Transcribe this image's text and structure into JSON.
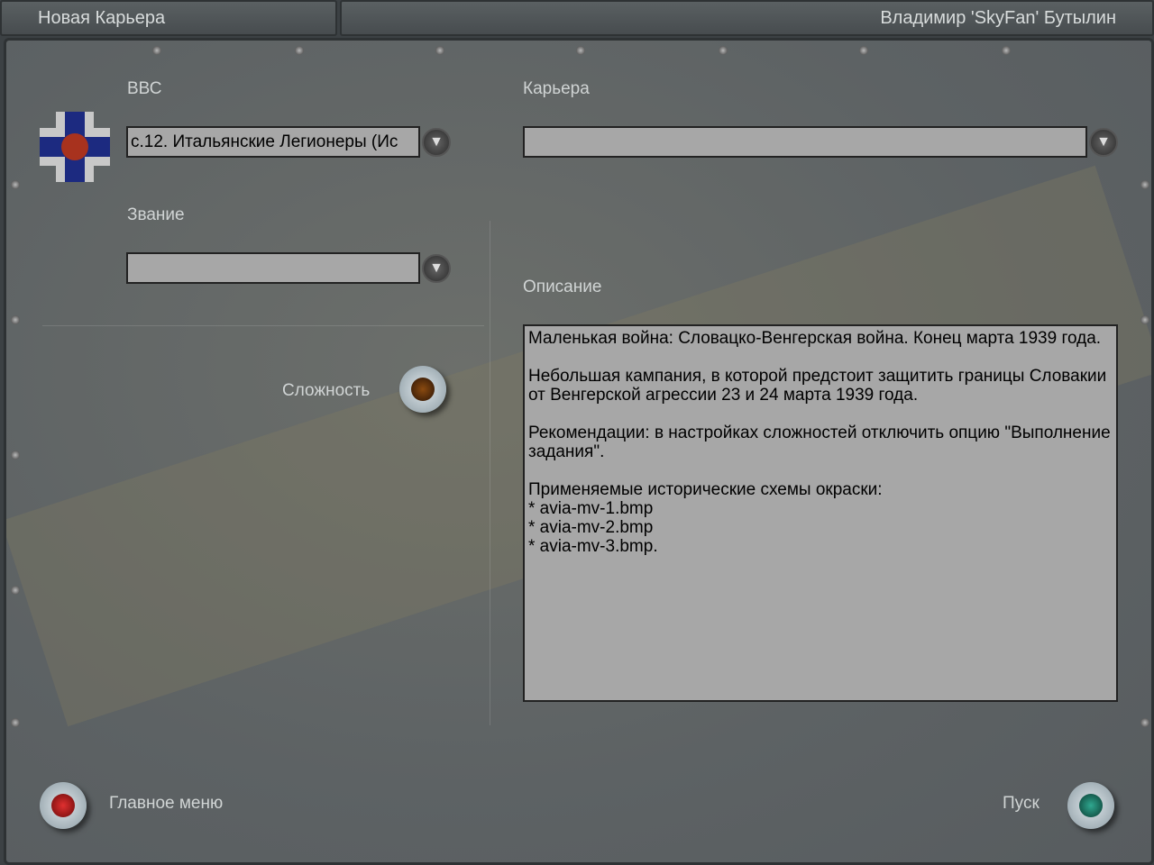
{
  "header": {
    "title": "Новая Карьера",
    "player": "Владимир 'SkyFan' Бутылин"
  },
  "air_force": {
    "label": "ВВС",
    "value": "с.12. Итальянские Легионеры (Ис"
  },
  "career": {
    "label": "Карьера",
    "value": ""
  },
  "rank": {
    "label": "Звание",
    "value": ""
  },
  "difficulty": {
    "label": "Сложность"
  },
  "description": {
    "label": "Описание",
    "text": "Маленькая война: Словацко-Венгерская война. Конец марта 1939 года.\n\nНебольшая кампания, в которой предстоит защитить границы Словакии от Венгерской агрессии 23 и 24 марта 1939 года.\n\nРекомендации: в настройках сложностей отключить опцию \"Выполнение задания\".\n\nПрименяемые исторические схемы окраски:\n* avia-mv-1.bmp\n* avia-mv-2.bmp\n* avia-mv-3.bmp."
  },
  "footer": {
    "main_menu": "Главное меню",
    "start": "Пуск"
  },
  "colors": {
    "insignia_blue": "#1c2a80",
    "insignia_red": "#a8321e",
    "red_button": "#b0141a",
    "green_button": "#1b7a68"
  }
}
